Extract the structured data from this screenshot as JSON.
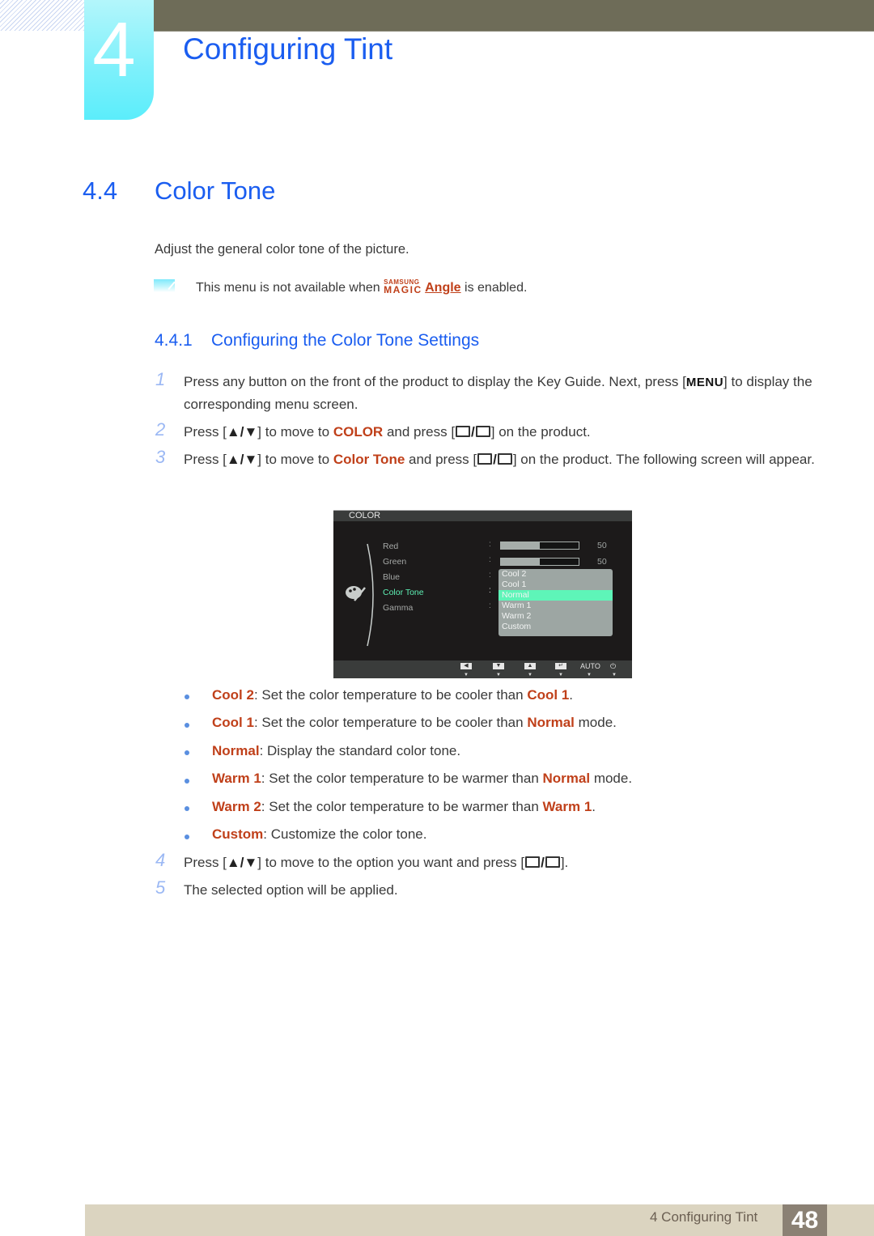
{
  "chapter": {
    "number": "4",
    "title": "Configuring Tint"
  },
  "section": {
    "number": "4.4",
    "title": "Color Tone"
  },
  "intro": "Adjust the general color tone of the picture.",
  "note": {
    "icon": "note-icon",
    "before": "This menu is not available when ",
    "brand_top": "SAMSUNG",
    "brand_bottom": "MAGIC",
    "feature": "Angle",
    "after": " is enabled."
  },
  "subsection": {
    "number": "4.4.1",
    "title": "Configuring the Color Tone Settings"
  },
  "steps": [
    {
      "num": "1",
      "parts": [
        "Press any button on the front of the product to display the Key Guide. Next, press [",
        "MENU",
        "] to display the corresponding menu screen."
      ]
    },
    {
      "num": "2",
      "parts": [
        "Press [",
        "▲/▼",
        "] to move to ",
        "COLOR",
        " and press [",
        "] on the product."
      ]
    },
    {
      "num": "3",
      "parts": [
        "Press [",
        "▲/▼",
        "] to move to ",
        "Color Tone",
        " and press [",
        "] on the product. The following screen will appear."
      ]
    },
    {
      "num": "4",
      "parts": [
        "Press [",
        "▲/▼",
        "] to move to the option you want and press [",
        "]."
      ]
    },
    {
      "num": "5",
      "parts": [
        "The selected option will be applied."
      ]
    }
  ],
  "osd": {
    "title": "COLOR",
    "items": [
      {
        "label": "Red",
        "value": "50",
        "level": 0.5
      },
      {
        "label": "Green",
        "value": "50",
        "level": 0.5
      },
      {
        "label": "Blue"
      },
      {
        "label": "Color Tone",
        "selected": true
      },
      {
        "label": "Gamma"
      }
    ],
    "dropdown": [
      "Cool 2",
      "Cool 1",
      "Normal",
      "Warm 1",
      "Warm 2",
      "Custom"
    ],
    "dropdown_selected": "Normal",
    "footer_buttons": [
      "◀",
      "▼",
      "▲",
      "↵",
      "AUTO",
      "⏻"
    ],
    "highlight_color": "#5ef5b8"
  },
  "options": [
    {
      "name": "Cool 2",
      "text": ": Set the color temperature to be cooler than ",
      "ref": "Cool 1",
      "tail": "."
    },
    {
      "name": "Cool 1",
      "text": ": Set the color temperature to be cooler than ",
      "ref": "Normal",
      "tail": " mode."
    },
    {
      "name": "Normal",
      "text": ": Display the standard color tone.",
      "ref": "",
      "tail": ""
    },
    {
      "name": "Warm 1",
      "text": ": Set the color temperature to be warmer than ",
      "ref": "Normal",
      "tail": " mode."
    },
    {
      "name": "Warm 2",
      "text": ": Set the color temperature to be warmer than ",
      "ref": "Warm 1",
      "tail": "."
    },
    {
      "name": "Custom",
      "text": ": Customize the color tone.",
      "ref": "",
      "tail": ""
    }
  ],
  "footer": {
    "label": "4 Configuring Tint",
    "page": "48"
  },
  "colors": {
    "heading": "#1a5df0",
    "highlight": "#c0401a",
    "topbar": "#6e6c58",
    "footer": "#dbd4c0",
    "page_box": "#8b8174"
  }
}
